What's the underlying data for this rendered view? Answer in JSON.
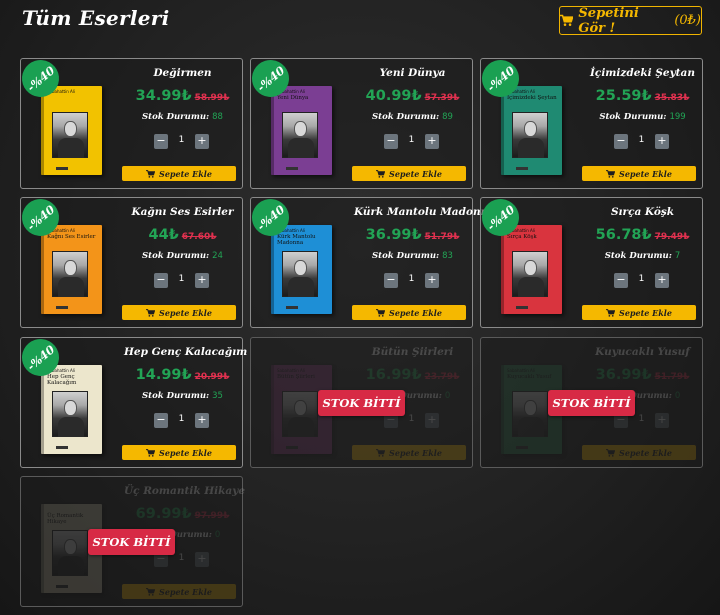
{
  "header": {
    "title": "Tüm Eserleri",
    "cart_button_label": "Sepetini Gör !",
    "cart_count": "(0₺)",
    "accent_color": "#f5b800"
  },
  "common": {
    "stock_label": "Stok Durumu:",
    "add_to_cart_label": "Sepete Ekle",
    "minus": "−",
    "plus": "+",
    "soldout_label": "STOK BİTTİ",
    "discount_color": "#1aa052",
    "price_color": "#22a455",
    "old_price_color": "#e0314f"
  },
  "products": [
    {
      "title": "Değirmen",
      "price": "34.99₺",
      "old_price": "58.99₺",
      "stock": "88",
      "qty": "1",
      "discount": "-%40",
      "soldout": false,
      "cover_color": "#f2c200",
      "author": "Sabahattin Ali",
      "cover_title": ""
    },
    {
      "title": "Yeni Dünya",
      "price": "40.99₺",
      "old_price": "57.39₺",
      "stock": "89",
      "qty": "1",
      "discount": "-%40",
      "soldout": false,
      "cover_color": "#7b3e93",
      "author": "Sabahattin Ali",
      "cover_title": "Yeni Dünya"
    },
    {
      "title": "İçimizdeki Şeytan",
      "price": "25.59₺",
      "old_price": "35.83₺",
      "stock": "199",
      "qty": "1",
      "discount": "-%40",
      "soldout": false,
      "cover_color": "#1f8a72",
      "author": "Sabahattin Ali",
      "cover_title": "İçimizdeki Şeytan"
    },
    {
      "title": "Kağnı Ses Esirler",
      "price": "44₺",
      "old_price": "67.60₺",
      "stock": "24",
      "qty": "1",
      "discount": "-%40",
      "soldout": false,
      "cover_color": "#f39419",
      "author": "Sabahattin Ali",
      "cover_title": "Kağnı Ses Esirler"
    },
    {
      "title": "Kürk Mantolu Madonna",
      "price": "36.99₺",
      "old_price": "51.79₺",
      "stock": "83",
      "qty": "1",
      "discount": "-%40",
      "soldout": false,
      "cover_color": "#1e8fd6",
      "author": "Sabahattin Ali",
      "cover_title": "Kürk Mantolu Madonna"
    },
    {
      "title": "Sırça Köşk",
      "price": "56.78₺",
      "old_price": "79.49₺",
      "stock": "7",
      "qty": "1",
      "discount": "-%40",
      "soldout": false,
      "cover_color": "#d9343e",
      "author": "Sabahattin Ali",
      "cover_title": "Sırça Köşk"
    },
    {
      "title": "Hep Genç Kalacağım",
      "price": "14.99₺",
      "old_price": "20.99₺",
      "stock": "35",
      "qty": "1",
      "discount": "-%40",
      "soldout": false,
      "cover_color": "#ece6cc",
      "author": "Sabahattin Ali",
      "cover_title": "Hep Genç Kalacağım"
    },
    {
      "title": "Bütün Şiirleri",
      "price": "16.99₺",
      "old_price": "23.79₺",
      "stock": "0",
      "qty": "1",
      "discount": "",
      "soldout": true,
      "cover_color": "#8a3a7a",
      "author": "Sabahattin Ali",
      "cover_title": "Bütün Şiirleri"
    },
    {
      "title": "Kuyucaklı Yusuf",
      "price": "36.99₺",
      "old_price": "51.79₺",
      "stock": "0",
      "qty": "1",
      "discount": "",
      "soldout": true,
      "cover_color": "#2e7a4f",
      "author": "Sabahattin Ali",
      "cover_title": "Kuyucaklı Yusuf"
    },
    {
      "title": "Üç Romantik Hikaye",
      "price": "69.99₺",
      "old_price": "97.99₺",
      "stock": "0",
      "qty": "1",
      "discount": "",
      "soldout": true,
      "cover_color": "#c9c2a6",
      "author": "",
      "cover_title": "Üç Romantik Hikaye"
    }
  ]
}
